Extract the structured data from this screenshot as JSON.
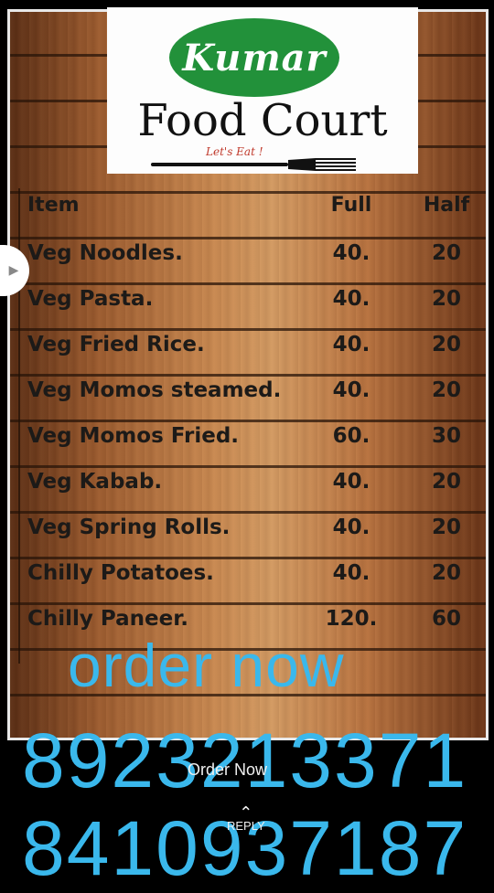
{
  "logo": {
    "brand": "Kumar",
    "title": "Food Court",
    "tagline": "Let's Eat !"
  },
  "menu": {
    "header": {
      "item": "Item",
      "full": "Full",
      "half": "Half"
    },
    "rows": [
      {
        "item": "Veg Noodles.",
        "full": "40.",
        "half": "20"
      },
      {
        "item": "Veg Pasta.",
        "full": "40.",
        "half": "20"
      },
      {
        "item": "Veg Fried Rice.",
        "full": "40.",
        "half": "20"
      },
      {
        "item": "Veg Momos steamed.",
        "full": "40.",
        "half": "20"
      },
      {
        "item": "Veg Momos Fried.",
        "full": "60.",
        "half": "30"
      },
      {
        "item": "Veg Kabab.",
        "full": "40.",
        "half": "20"
      },
      {
        "item": "Veg Spring Rolls.",
        "full": "40.",
        "half": "20"
      },
      {
        "item": "Chilly Potatoes.",
        "full": "40.",
        "half": "20"
      },
      {
        "item": "Chilly Paneer.",
        "full": "120.",
        "half": "60"
      }
    ]
  },
  "overlay": {
    "cta": "order now",
    "phone1": "8923213371",
    "phone2": "8410937187"
  },
  "actions": {
    "order_button": "Order Now",
    "reply": "REPLY"
  },
  "colors": {
    "overlay_text": "#3ab8ec",
    "logo_green": "#22913a"
  }
}
